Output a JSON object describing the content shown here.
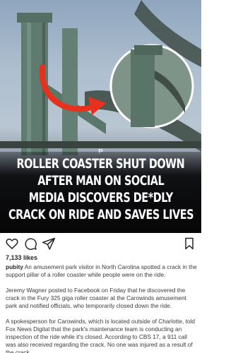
{
  "post": {
    "headline_lines": [
      "ROLLER COASTER SHUT DOWN",
      "AFTER MAN ON SOCIAL",
      "MEDIA DISCOVERS DE*DLY",
      "CRACK ON RIDE AND SAVES LIVES"
    ],
    "watermark": "P",
    "colors": {
      "highlight_circle": "#ffffff",
      "arrow": "#e8301c",
      "structure": "#5f7b70"
    }
  },
  "actions": {
    "like_icon": "heart-icon",
    "comment_icon": "comment-icon",
    "share_icon": "paper-plane-icon",
    "save_icon": "bookmark-icon"
  },
  "likes": "7,133 likes",
  "caption": {
    "username": "pubity",
    "paragraphs": [
      "An amusement park visitor in North Carolina spotted a crack in the support pillar of a roller coaster while people were on the ride.",
      "Jeremy Wagner posted to Facebook on Friday that he discovered the crack in the Fury 325 giga roller coaster at the Carowinds amusement park and notified officials, who temporarily closed down the ride.",
      "A spokesperson for Carowinds, which is located outside of Charlotte, told Fox News Digital that the park's maintenance team is conducting an inspection of the ride while it's closed. According to CBS 17, a 911 call was also received regarding the crack. No one was injured as a result of the crack."
    ]
  }
}
